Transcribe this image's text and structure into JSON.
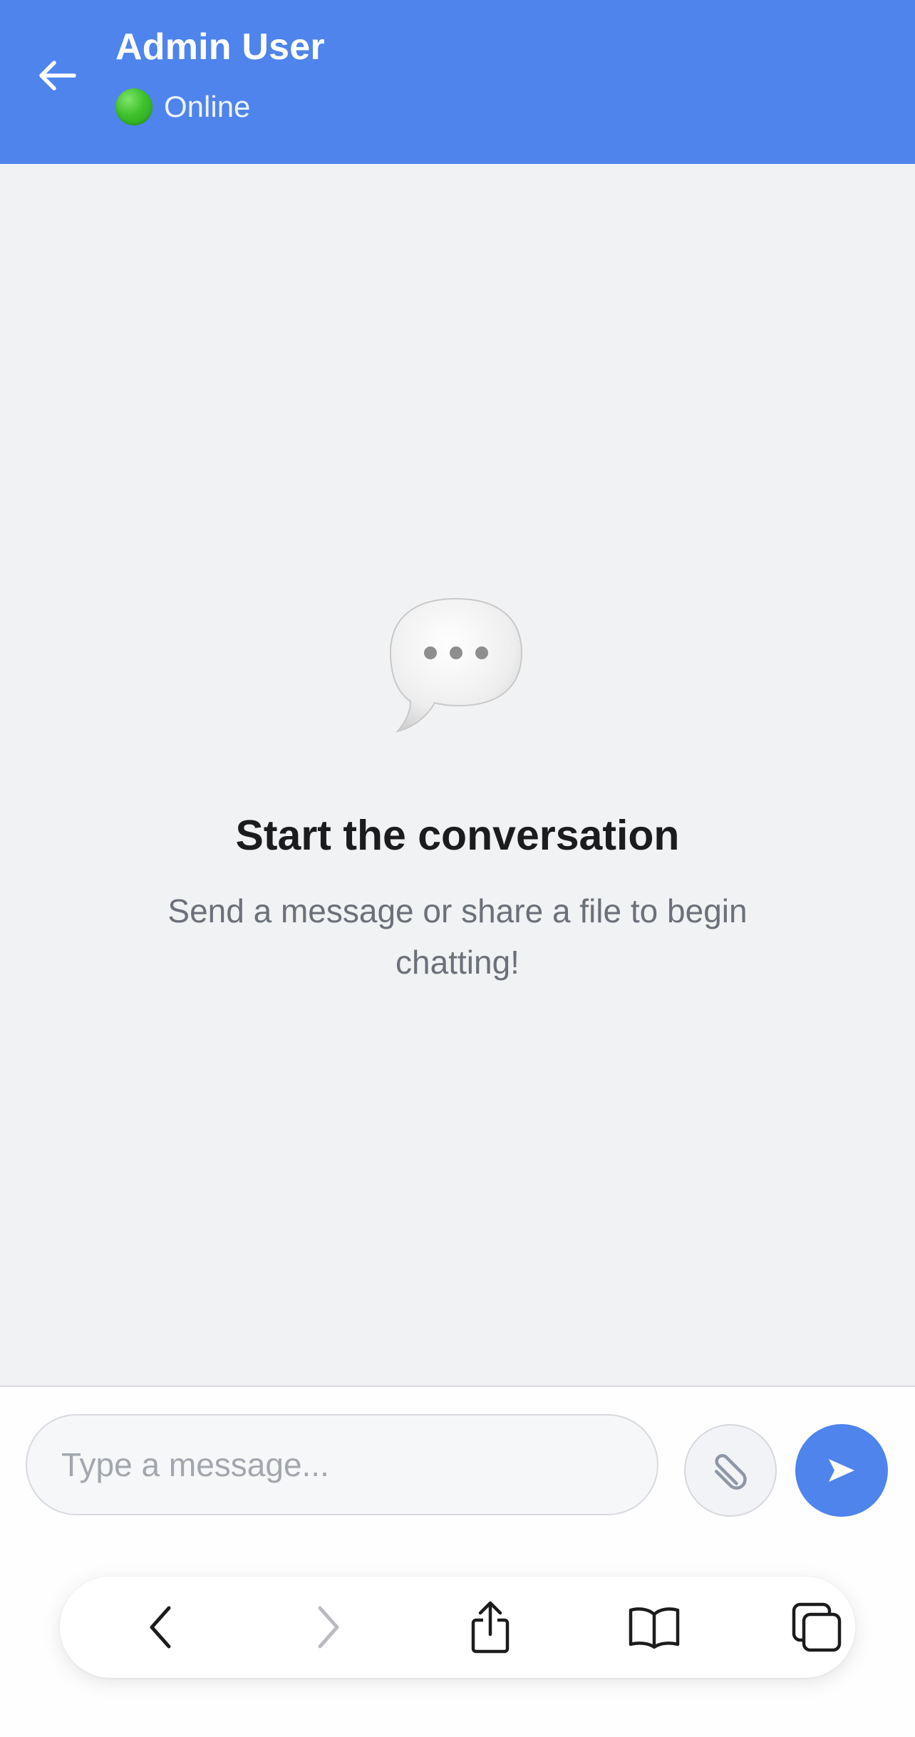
{
  "header": {
    "title": "Admin User",
    "status": "Online",
    "background_color": "#4e84ec",
    "status_color": "#3fc12c"
  },
  "empty_state": {
    "icon": "speech-bubble-icon",
    "title": "Start the conversation",
    "subtitle": "Send a message or share a file to begin chatting!"
  },
  "composer": {
    "placeholder": "Type a message...",
    "value": "",
    "attach_icon": "paperclip-icon",
    "send_icon": "send-icon",
    "send_color": "#4e84ec"
  },
  "browser_toolbar": {
    "items": [
      {
        "icon": "chevron-left-icon",
        "enabled": true
      },
      {
        "icon": "chevron-right-icon",
        "enabled": false
      },
      {
        "icon": "share-icon",
        "enabled": true
      },
      {
        "icon": "bookmarks-icon",
        "enabled": true
      },
      {
        "icon": "tabs-icon",
        "enabled": true
      }
    ]
  }
}
